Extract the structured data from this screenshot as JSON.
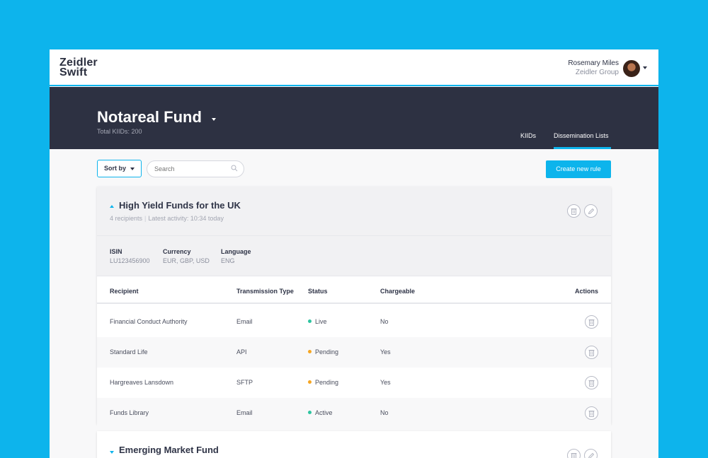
{
  "brand": {
    "line1": "Zeidler",
    "line2": "Swift"
  },
  "user": {
    "name": "Rosemary Miles",
    "org": "Zeidler Group"
  },
  "fund": {
    "title": "Notareal Fund",
    "total": "Total KIIDs: 200"
  },
  "tabs": [
    {
      "label": "KIIDs",
      "active": false
    },
    {
      "label": "Dissemination Lists",
      "active": true
    }
  ],
  "toolbar": {
    "sort_label": "Sort by",
    "search_placeholder": "Search",
    "create_label": "Create new rule"
  },
  "lists": [
    {
      "title": "High Yield Funds for the UK",
      "recipients": "4 recipients",
      "activity": "Latest activity: 10:34 today",
      "expanded": true,
      "meta": [
        {
          "label": "ISIN",
          "value": "LU123456900"
        },
        {
          "label": "Currency",
          "value": "EUR, GBP, USD"
        },
        {
          "label": "Language",
          "value": "ENG"
        }
      ],
      "columns": [
        "Recipient",
        "Transmission Type",
        "Status",
        "Chargeable",
        "Actions"
      ],
      "rows": [
        {
          "recipient": "Financial Conduct Authority",
          "type": "Email",
          "status": "Live",
          "status_color": "#2ec4a0",
          "chargeable": "No"
        },
        {
          "recipient": "Standard Life",
          "type": "API",
          "status": "Pending",
          "status_color": "#f5a623",
          "chargeable": "Yes"
        },
        {
          "recipient": "Hargreaves Lansdown",
          "type": "SFTP",
          "status": "Pending",
          "status_color": "#f5a623",
          "chargeable": "Yes"
        },
        {
          "recipient": "Funds Library",
          "type": "Email",
          "status": "Active",
          "status_color": "#2ec4a0",
          "chargeable": "No"
        }
      ]
    },
    {
      "title": "Emerging Market Fund",
      "expanded": false
    }
  ],
  "colors": {
    "accent": "#0db4ec",
    "header": "#2d3142",
    "live": "#2ec4a0",
    "pending": "#f5a623"
  }
}
